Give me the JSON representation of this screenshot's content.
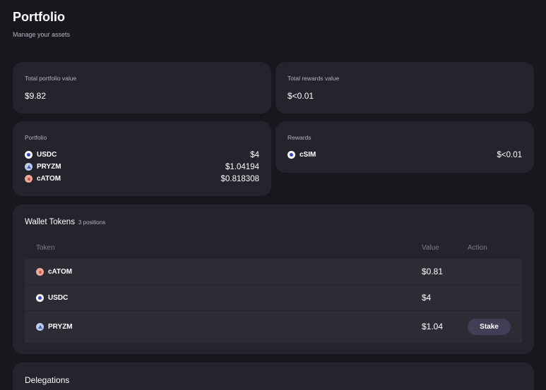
{
  "header": {
    "title": "Portfolio",
    "subtitle": "Manage your assets"
  },
  "summary": {
    "total_portfolio": {
      "label": "Total portfolio value",
      "value": "$9.82"
    },
    "total_rewards": {
      "label": "Total rewards value",
      "value": "$<0.01"
    }
  },
  "portfolio": {
    "label": "Portfolio",
    "items": [
      {
        "name": "USDC",
        "value": "$4",
        "icon": "usdc-icon"
      },
      {
        "name": "PRYZM",
        "value": "$1.04194",
        "icon": "pryzm-icon"
      },
      {
        "name": "cATOM",
        "value": "$0.818308",
        "icon": "catom-icon"
      }
    ]
  },
  "rewards": {
    "label": "Rewards",
    "items": [
      {
        "name": "cSIM",
        "value": "$<0.01",
        "icon": "csim-icon"
      }
    ]
  },
  "wallet": {
    "title": "Wallet Tokens",
    "count": "3 positions",
    "columns": {
      "token": "Token",
      "value": "Value",
      "action": "Action"
    },
    "rows": [
      {
        "token": "cATOM",
        "value": "$0.81",
        "icon": "catom-icon"
      },
      {
        "token": "USDC",
        "value": "$4",
        "icon": "usdc-icon"
      },
      {
        "token": "PRYZM",
        "value": "$1.04",
        "icon": "pryzm-icon",
        "action": "Stake"
      }
    ]
  },
  "delegations": {
    "title": "Delegations"
  }
}
